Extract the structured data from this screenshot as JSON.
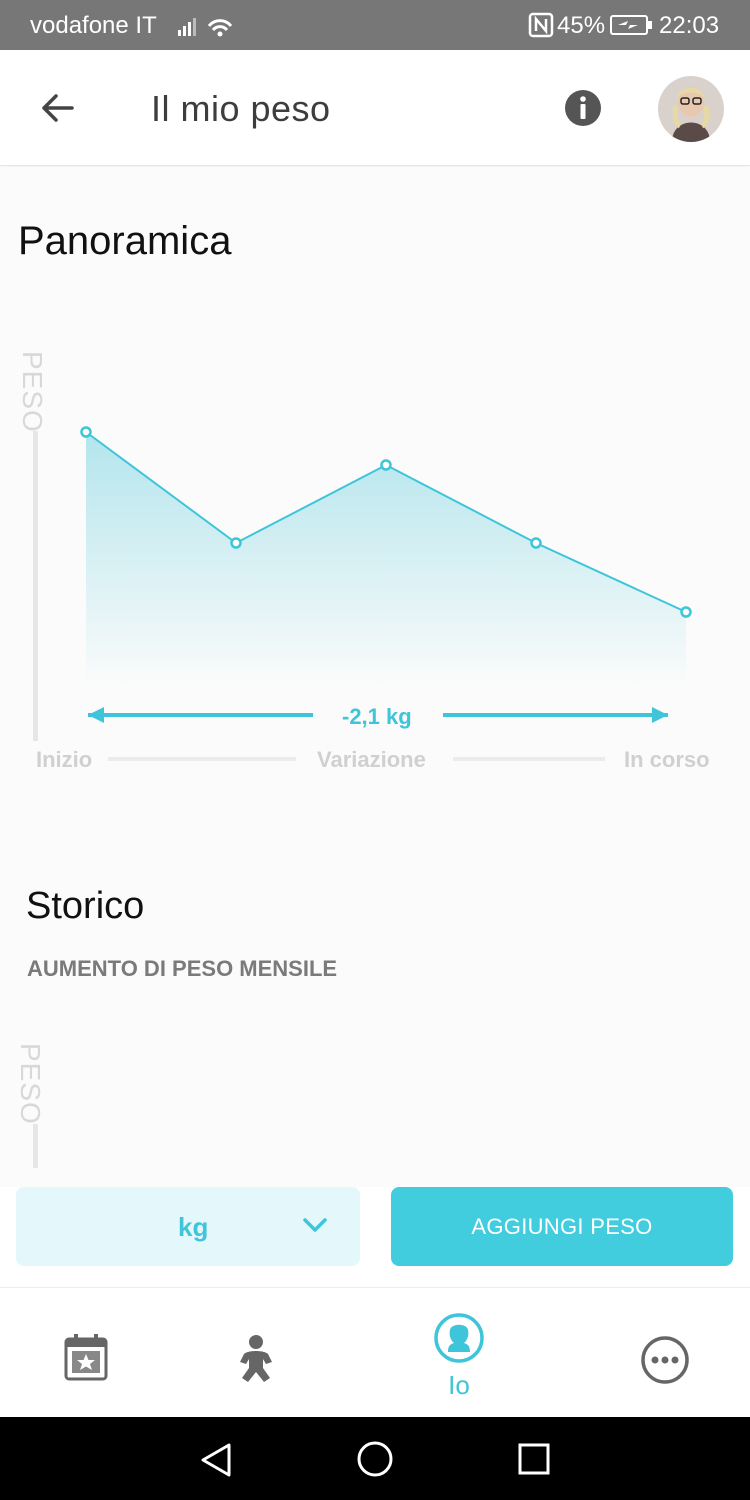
{
  "status_bar": {
    "carrier": "vodafone IT",
    "battery": "45%",
    "time": "22:03",
    "icons": [
      "signal-icon",
      "wifi-icon",
      "nfc-icon",
      "battery-charging-icon"
    ]
  },
  "header": {
    "title": "Il mio peso",
    "back_icon": "back-arrow-icon",
    "info_icon": "info-icon",
    "avatar": "user-avatar"
  },
  "overview": {
    "title": "Panoramica",
    "chart_data": {
      "type": "area",
      "ylabel": "PESO",
      "x_labels": [
        "Inizio",
        "Variazione",
        "In corso"
      ],
      "points": [
        {
          "x": 0,
          "y": 0.85
        },
        {
          "x": 1,
          "y": 0.48
        },
        {
          "x": 2,
          "y": 0.74
        },
        {
          "x": 3,
          "y": 0.48
        },
        {
          "x": 4,
          "y": 0.25
        }
      ],
      "change_label": "-2,1 kg",
      "colors": {
        "line": "#3ec5d9",
        "fill": "#a6e1ea",
        "axis": "#e6e6e6"
      }
    }
  },
  "history": {
    "title": "Storico",
    "subtitle": "AUMENTO DI PESO MENSILE",
    "ylabel": "PESO"
  },
  "actions": {
    "unit": "kg",
    "add_label": "AGGIUNGI PESO"
  },
  "bottom_nav": {
    "items": [
      {
        "name": "calendar",
        "label": "",
        "icon": "calendar-star-icon"
      },
      {
        "name": "baby",
        "label": "",
        "icon": "baby-icon"
      },
      {
        "name": "me",
        "label": "Io",
        "icon": "woman-icon",
        "active": true
      },
      {
        "name": "more",
        "label": "",
        "icon": "more-icon"
      }
    ]
  },
  "colors": {
    "accent": "#42cddf",
    "accent_light": "#e4f8fb",
    "status_bar": "#777777"
  }
}
